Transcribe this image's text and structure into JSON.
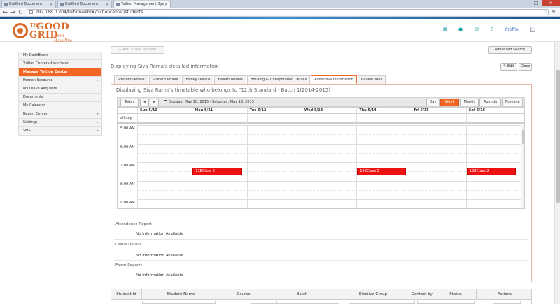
{
  "browser": {
    "tabs": [
      {
        "title": "Untitled Document",
        "active": false
      },
      {
        "title": "Untitled Document",
        "active": false
      },
      {
        "title": "Tuition Management Sys",
        "active": true
      }
    ],
    "url": "192.168.0.204/tuitionweb/#/tuitioncenter/students",
    "nav": {
      "back": "←",
      "forward": "→",
      "reload": "↻"
    }
  },
  "header": {
    "logo": {
      "the": "THE",
      "good": "GOOD",
      "grid": "GRID",
      "tagline": "from Ravaltra"
    },
    "icons": [
      "grid-icon",
      "users-icon",
      "mail-icon",
      "bell-icon"
    ],
    "profile_label": "Profile",
    "accent_color": "#f26522"
  },
  "sidebar": {
    "items": [
      {
        "label": "My DashBoard",
        "active": false,
        "arrow": ""
      },
      {
        "label": "Tuition Centers Associated",
        "active": false,
        "arrow": ""
      },
      {
        "label": "Manage Tuition Center",
        "active": true,
        "arrow": ""
      },
      {
        "label": "Human Resource",
        "active": false,
        "arrow": "▸"
      },
      {
        "label": "My Leave Requests",
        "active": false,
        "arrow": ""
      },
      {
        "label": "Documents",
        "active": false,
        "arrow": ""
      },
      {
        "label": "My Calendar",
        "active": false,
        "arrow": ""
      },
      {
        "label": "Report Center",
        "active": false,
        "arrow": "▸"
      },
      {
        "label": "Settings",
        "active": false,
        "arrow": "▸"
      },
      {
        "label": "SMS",
        "active": false,
        "arrow": "▸"
      }
    ]
  },
  "main": {
    "add_button": "+ Add a New Student",
    "advanced_search": "Advanced Search",
    "detail_title": "Displaying Siva Rama's detailed information",
    "edit_label": "✎ Edit",
    "close_label": "Close",
    "tabs": [
      {
        "label": "Student Details",
        "active": false
      },
      {
        "label": "Student Profile",
        "active": false
      },
      {
        "label": "Family Details",
        "active": false
      },
      {
        "label": "Health Details",
        "active": false
      },
      {
        "label": "Housing & Transpotation Details",
        "active": false
      },
      {
        "label": "Additional Information",
        "active": true
      },
      {
        "label": "Issues/Tasks",
        "active": false
      }
    ],
    "timetable_title": "Displaying Siva Rama's timetable who belongs to \"12th Standard - Batch 1(2014-2015)",
    "calendar": {
      "today": "Today",
      "prev": "◂",
      "next": "▸",
      "range": "Sunday, May 10, 2015 - Saturday, May 16, 2015",
      "views": [
        {
          "label": "Day",
          "active": false
        },
        {
          "label": "Week",
          "active": true
        },
        {
          "label": "Month",
          "active": false
        },
        {
          "label": "Agenda",
          "active": false
        },
        {
          "label": "Timeline",
          "active": false
        }
      ],
      "days": [
        "Sun 5/10",
        "Mon 5/11",
        "Tue 5/12",
        "Wed 5/13",
        "Thu 5/14",
        "Fri 5/15",
        "Sat 5/16"
      ],
      "allday_label": "all day",
      "times": [
        "5:00 AM",
        "6:00 AM",
        "7:00 AM",
        "8:00 AM",
        "9:00 AM"
      ],
      "events": [
        {
          "day": 1,
          "title": "12BClass 2"
        },
        {
          "day": 4,
          "title": "12BClass 2"
        },
        {
          "day": 6,
          "title": "12BClass 2"
        }
      ],
      "event_color": "#ee1111"
    },
    "reports": [
      {
        "label": "Attendence Report",
        "value": "No Information Available"
      },
      {
        "label": "Leave Details",
        "value": "No Information Available"
      },
      {
        "label": "Exam Reports",
        "value": "No Information Available"
      }
    ],
    "table_headers": [
      "Student Id",
      "Student Name",
      "Course",
      "Batch",
      "Elective Group",
      "Contact by",
      "Status",
      "Actions"
    ]
  }
}
